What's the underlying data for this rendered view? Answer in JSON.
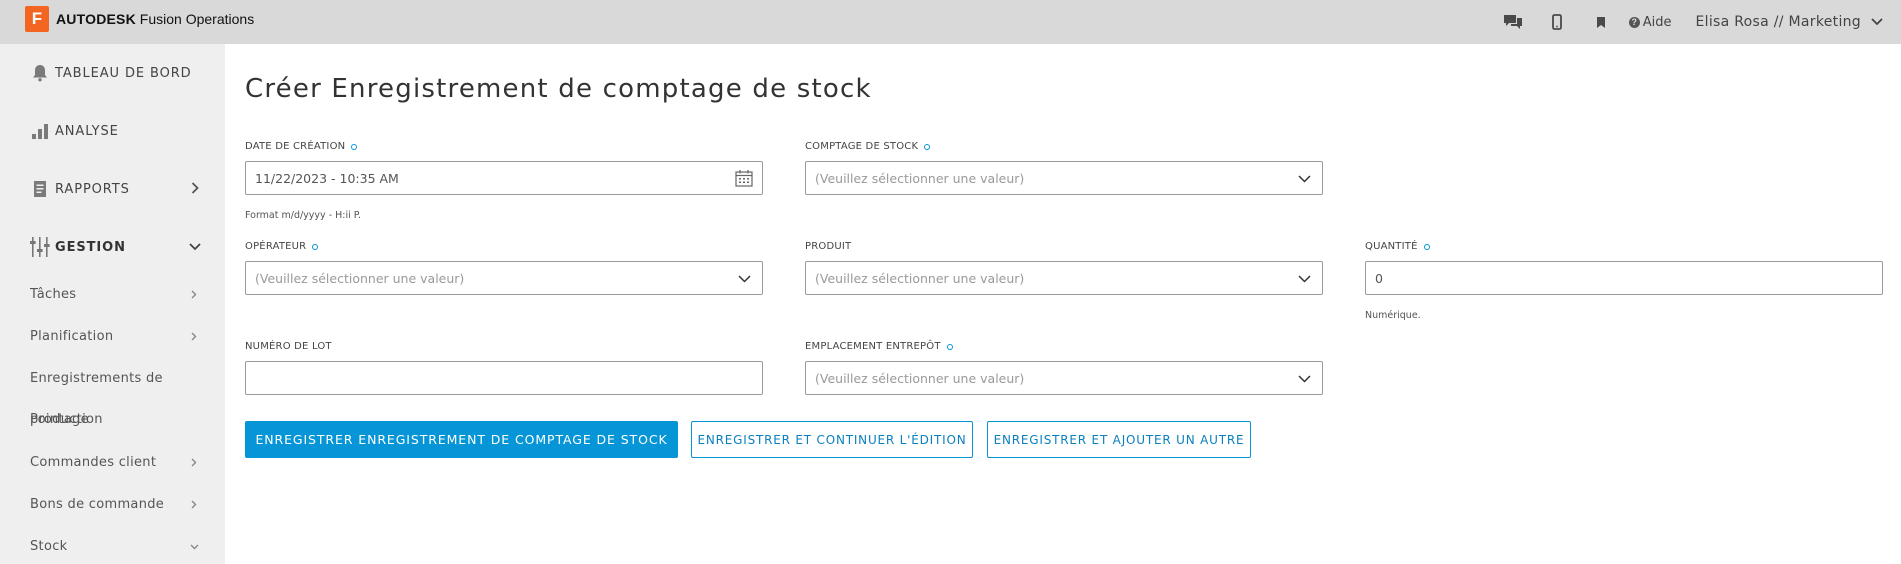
{
  "app": {
    "logo_letter": "F",
    "brand_bold": "AUTODESK",
    "brand_rest": " Fusion Operations",
    "brand_color": "#f26622"
  },
  "topbar": {
    "icons": [
      "chat-icon",
      "mobile-icon",
      "bookmark-icon"
    ],
    "help_label": "Aide",
    "user_label": "Elisa Rosa // Marketing"
  },
  "sidebar": {
    "main": [
      {
        "label": "TABLEAU DE BORD",
        "icon": "bell-icon"
      },
      {
        "label": "ANALYSE",
        "icon": "bar-chart-icon"
      },
      {
        "label": "RAPPORTS",
        "icon": "document-icon"
      },
      {
        "label": "GESTION",
        "icon": "sliders-icon"
      }
    ],
    "sub": [
      {
        "label": "Tâches"
      },
      {
        "label": "Planification"
      },
      {
        "label": "Enregistrements de"
      },
      {
        "label": "Commandes client"
      },
      {
        "label": "Bons de commande"
      },
      {
        "label": "Stock"
      }
    ],
    "overlap": [
      "Pointage",
      "production"
    ]
  },
  "page": {
    "title": "Créer Enregistrement de comptage de stock"
  },
  "form": {
    "date_label": "DATE DE CRÉATION",
    "date_value": "11/22/2023 - 10:35 AM",
    "date_hint": "Format m/d/yyyy - H:ii P.",
    "stock_count_label": "COMPTAGE DE STOCK",
    "stock_count_placeholder": "(Veuillez sélectionner une valeur)",
    "operator_label": "OPÉRATEUR",
    "operator_placeholder": "(Veuillez sélectionner une valeur)",
    "product_label": "PRODUIT",
    "product_placeholder": "(Veuillez sélectionner une valeur)",
    "quantity_label": "QUANTITÉ",
    "quantity_value": "0",
    "quantity_hint": "Numérique.",
    "lot_label": "NUMÉRO DE LOT",
    "lot_value": "",
    "location_label": "EMPLACEMENT ENTREPÔT",
    "location_placeholder": "(Veuillez sélectionner une valeur)"
  },
  "buttons": {
    "save": "ENREGISTRER ENREGISTREMENT DE COMPTAGE DE STOCK",
    "save_continue": "ENREGISTRER ET CONTINUER L'ÉDITION",
    "save_add": "ENREGISTRER ET AJOUTER UN AUTRE"
  },
  "colors": {
    "accent": "#0696d7",
    "topbar": "#d9d9d9",
    "sidebar": "#efefef"
  }
}
